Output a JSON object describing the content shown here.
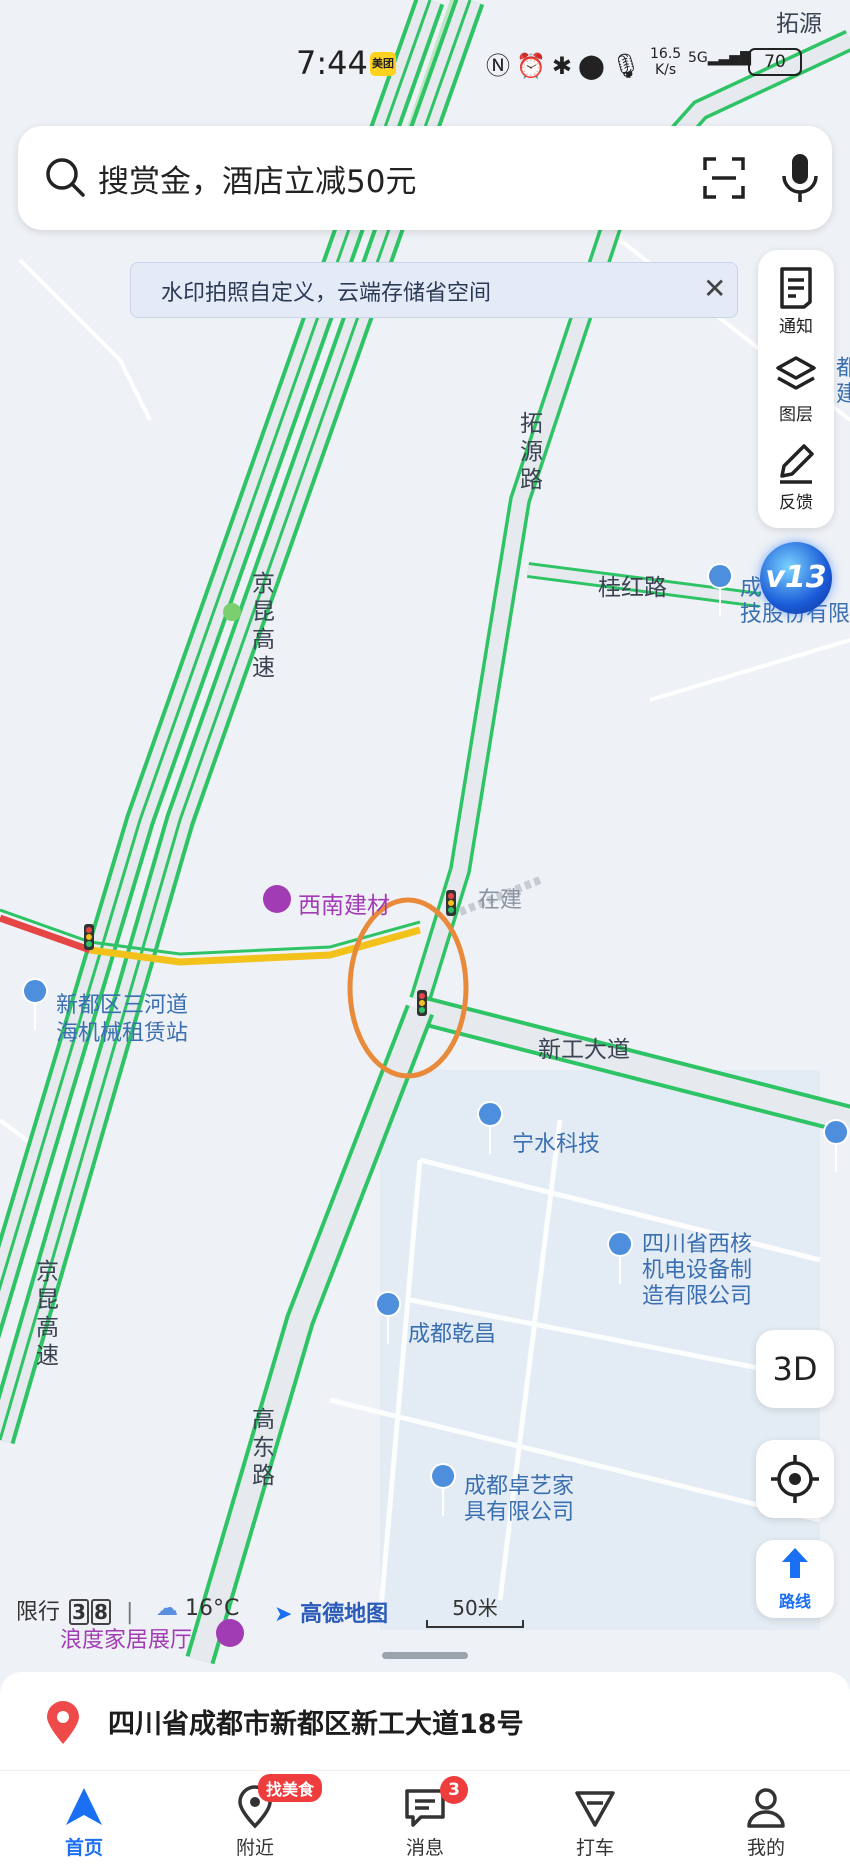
{
  "status_bar": {
    "time": "7:44",
    "meituan_badge": "美团",
    "net_speed_value": "16.5",
    "net_speed_unit": "K/s",
    "signal": "5G",
    "battery": "70"
  },
  "search": {
    "placeholder": "搜赏金，酒店立减50元"
  },
  "banner": {
    "text": "水印拍照自定义，云端存储省空间",
    "close_glyph": "✕"
  },
  "right_toolbar": {
    "items": [
      {
        "label": "通知",
        "icon": "notice-icon"
      },
      {
        "label": "图层",
        "icon": "layers-icon"
      },
      {
        "label": "反馈",
        "icon": "feedback-icon"
      }
    ]
  },
  "floating_badge": {
    "label": "v13"
  },
  "map": {
    "roads": {
      "jingkun_upper": "京昆高速",
      "jingkun_lower": "京昆高速",
      "tuoyuan": "拓源路",
      "tuoyuan_top": "拓源",
      "guihong": "桂红路",
      "xingong": "新工大道",
      "gaodong": "高东路",
      "zaijian": "在建"
    },
    "pois": [
      {
        "name": "西南建材",
        "type": "purple"
      },
      {
        "name": "新都区三河道海机械租赁站",
        "line1": "新都区三河道",
        "line2": "海机械租赁站"
      },
      {
        "name": "宁水科技"
      },
      {
        "name": "四川省西核机电设备制造有限公司",
        "line1": "四川省西核",
        "line2": "机电设备制",
        "line3": "造有限公司"
      },
      {
        "name": "成都乾昌"
      },
      {
        "name": "成都卓艺家具有限公司",
        "line1": "成都卓艺家",
        "line2": "具有限公司"
      },
      {
        "name": "浪度家居展厅",
        "type": "purple"
      },
      {
        "name": "成都",
        "line1": "成都",
        "line2": "技股份有限"
      }
    ],
    "edge_labels": {
      "right_top": "都",
      "right_mid": "建"
    }
  },
  "info_line": {
    "xianxing_label": "限行",
    "plate_digits": [
      "3",
      "8"
    ],
    "separator": "|",
    "temperature": "16°C",
    "brand": "高德地图",
    "scale": "50米"
  },
  "controls": {
    "three_d": "3D",
    "route_label": "路线"
  },
  "address": {
    "text": "四川省成都市新都区新工大道18号"
  },
  "tabbar": {
    "tabs": [
      {
        "label": "首页",
        "active": true
      },
      {
        "label": "附近"
      },
      {
        "label": "消息"
      },
      {
        "label": "打车"
      },
      {
        "label": "我的"
      }
    ],
    "food_badge": "找美食",
    "message_count": "3"
  },
  "colors": {
    "road_green": "#2ec466",
    "accent_blue": "#1a6ff3",
    "highlight_orange": "#e98a3a",
    "badge_red": "#ef3d3d"
  }
}
